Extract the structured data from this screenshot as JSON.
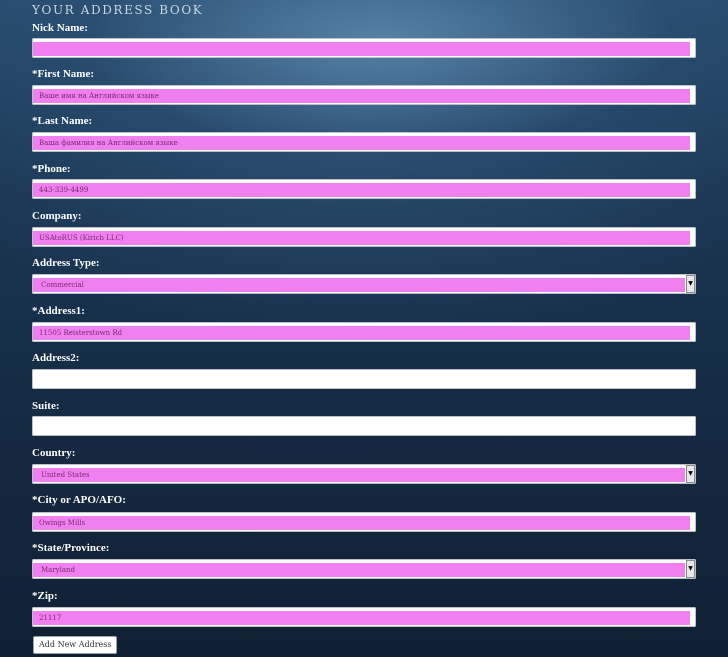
{
  "title": "YOUR ADDRESS BOOK",
  "fields": {
    "nickname": {
      "label": "Nick Name:",
      "value": ""
    },
    "first_name": {
      "label": "*First Name:",
      "value": "Ваше имя на Английском языке"
    },
    "last_name": {
      "label": "*Last Name:",
      "value": "Ваша фамилия на Английском языке"
    },
    "phone": {
      "label": "*Phone:",
      "value": "443-339-4499"
    },
    "company": {
      "label": "Company:",
      "value": "USAtoRUS (Kirich LLC)"
    },
    "address_type": {
      "label": "Address Type:",
      "value": "Commercial"
    },
    "address1": {
      "label": "*Address1:",
      "value": "11505 Reisterstown Rd"
    },
    "address2": {
      "label": "Address2:",
      "value": ""
    },
    "suite": {
      "label": "Suite:",
      "value": ""
    },
    "country": {
      "label": "Country:",
      "value": "United States"
    },
    "city": {
      "label": "*City or APO/AFO:",
      "value": "Owings Mills"
    },
    "state": {
      "label": "*State/Province:",
      "value": "Maryland"
    },
    "zip": {
      "label": "*Zip:",
      "value": "21117"
    }
  },
  "submit_label": "Add New Address",
  "colors": {
    "autofill_highlight": "#f07ff0",
    "label_text": "#ffffff",
    "title_text": "#c9d6e3"
  },
  "icons": {
    "select_arrow": "chevron-down-icon"
  }
}
